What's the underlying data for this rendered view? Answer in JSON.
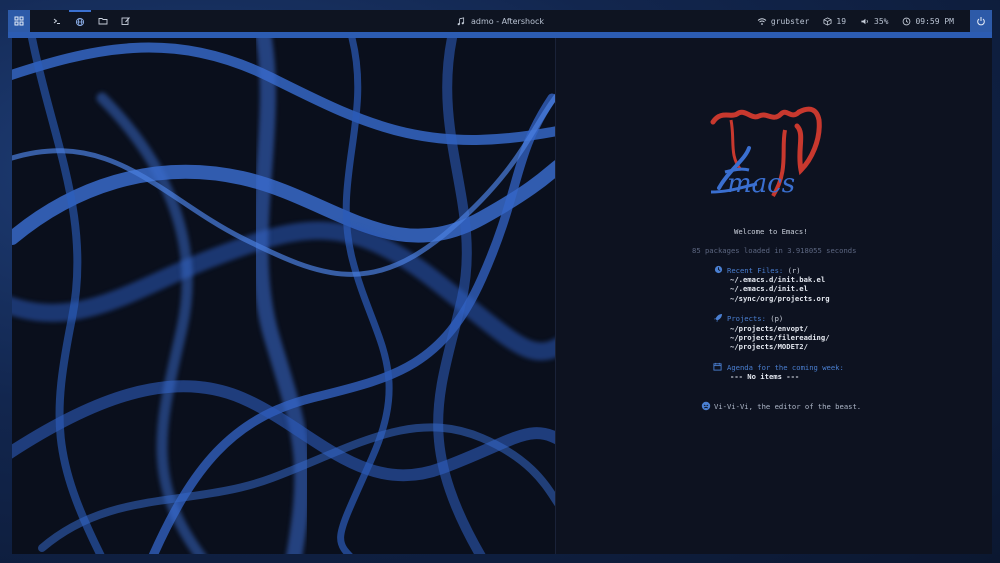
{
  "topbar": {
    "media": "admo - Aftershock",
    "network": "grubster",
    "updates": "19",
    "volume": "35%",
    "clock": "09:59 PM"
  },
  "dashboard": {
    "welcome": "Welcome to Emacs!",
    "packages": "85 packages loaded in 3.918055 seconds",
    "recent": {
      "title": "Recent Files:",
      "key": "(r)",
      "items": [
        "~/.emacs.d/init.bak.el",
        "~/.emacs.d/init.el",
        "~/sync/org/projects.org"
      ]
    },
    "projects": {
      "title": "Projects:",
      "key": "(p)",
      "items": [
        "~/projects/envopt/",
        "~/projects/filereading/",
        "~/projects/MODET2/"
      ]
    },
    "agenda": {
      "title": "Agenda for the coming week:",
      "empty": "--- No items ---"
    },
    "footer": "Vi-Vi-Vi, the editor of the beast."
  },
  "colors": {
    "accent": "#2c5cb2",
    "emacs_red": "#c8382e",
    "emacs_blue": "#3a6fd0",
    "panel": "#0e1421"
  },
  "icons": [
    "grid-icon",
    "terminal-icon",
    "globe-icon",
    "folder-icon",
    "edit-icon",
    "music-icon",
    "wifi-icon",
    "package-icon",
    "volume-icon",
    "clock-icon",
    "power-icon",
    "recent-icon",
    "rocket-icon",
    "calendar-icon",
    "evil-icon"
  ]
}
